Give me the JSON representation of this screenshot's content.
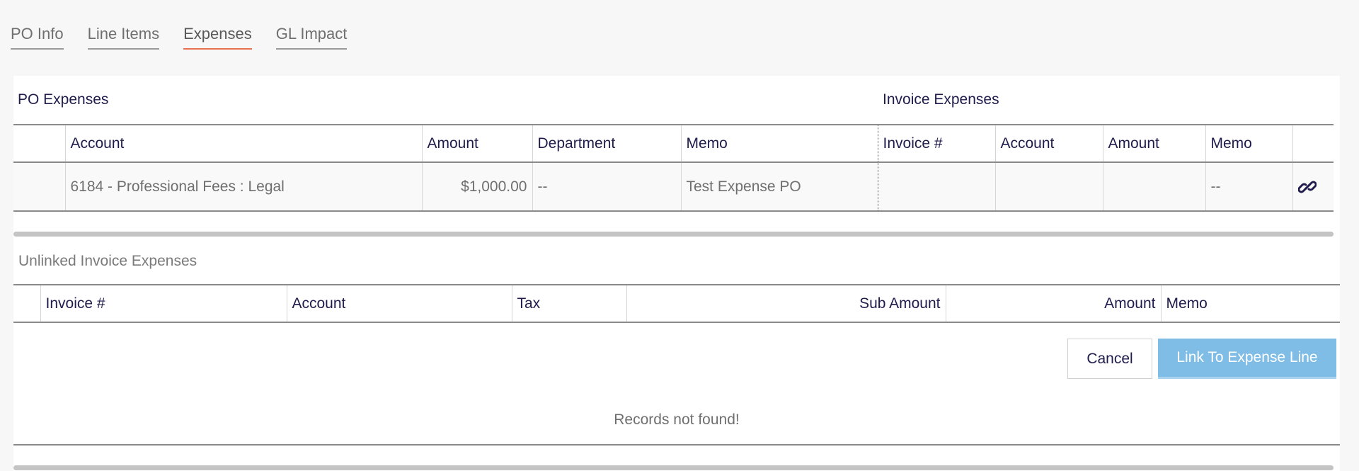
{
  "tabs": [
    {
      "label": "PO Info",
      "active": false
    },
    {
      "label": "Line Items",
      "active": false
    },
    {
      "label": "Expenses",
      "active": true
    },
    {
      "label": "GL Impact",
      "active": false
    }
  ],
  "po_expenses": {
    "title": "PO Expenses",
    "headers": {
      "account": "Account",
      "amount": "Amount",
      "department": "Department",
      "memo": "Memo"
    },
    "rows": [
      {
        "account": "6184 - Professional Fees : Legal",
        "amount": "$1,000.00",
        "department": "--",
        "memo": "Test Expense PO"
      }
    ]
  },
  "invoice_expenses": {
    "title": "Invoice Expenses",
    "headers": {
      "invoice_no": "Invoice #",
      "account": "Account",
      "amount": "Amount",
      "memo": "Memo"
    },
    "rows": [
      {
        "invoice_no": "",
        "account": "",
        "amount": "",
        "memo": "--",
        "link_icon": "link-icon"
      }
    ]
  },
  "unlinked": {
    "title": "Unlinked Invoice Expenses",
    "headers": {
      "invoice_no": "Invoice #",
      "account": "Account",
      "tax": "Tax",
      "sub_amount": "Sub Amount",
      "amount": "Amount",
      "memo": "Memo"
    },
    "empty_message": "Records not found!"
  },
  "buttons": {
    "cancel": "Cancel",
    "link": "Link To Expense Line"
  },
  "colors": {
    "active_tab_underline": "#e8704f",
    "primary_button": "#7fbde6",
    "heading_text": "#1f1b4d"
  }
}
